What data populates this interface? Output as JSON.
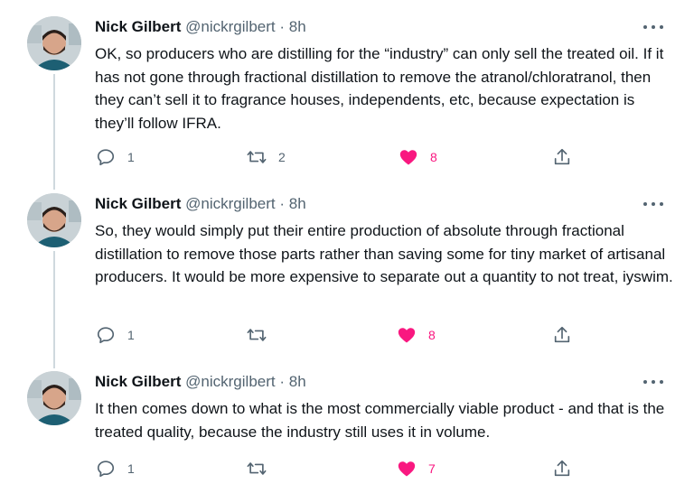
{
  "tweets": [
    {
      "author_name": "Nick Gilbert",
      "author_handle": "@nickrgilbert",
      "separator": "·",
      "time": "8h",
      "text": "OK, so producers who are distilling for the “industry” can only sell the treated oil. If it has not gone through fractional distillation to remove the atranol/chloratranol, then they can’t sell it to fragrance houses, independents, etc, because expectation is they’ll follow IFRA.",
      "reply_count": "1",
      "retweet_count": "2",
      "like_count": "8"
    },
    {
      "author_name": "Nick Gilbert",
      "author_handle": "@nickrgilbert",
      "separator": "·",
      "time": "8h",
      "text": "So, they would simply put their entire production of absolute through fractional distillation to remove those parts rather than saving some for tiny market of artisanal producers. It would be more expensive to separate out a quantity to not treat, iyswim.",
      "reply_count": "1",
      "retweet_count": "",
      "like_count": "8"
    },
    {
      "author_name": "Nick Gilbert",
      "author_handle": "@nickrgilbert",
      "separator": "·",
      "time": "8h",
      "text": "It then comes down to what is the most commercially viable product - and that is the treated quality, because the industry still uses it in volume.",
      "reply_count": "1",
      "retweet_count": "",
      "like_count": "7"
    }
  ],
  "icons": {
    "reply": "reply-icon",
    "retweet": "retweet-icon",
    "like": "heart-icon",
    "share": "share-icon",
    "more": "more-icon"
  },
  "colors": {
    "text": "#0f1419",
    "secondary": "#536471",
    "like": "#f91880",
    "thread_line": "#cfd9de"
  }
}
